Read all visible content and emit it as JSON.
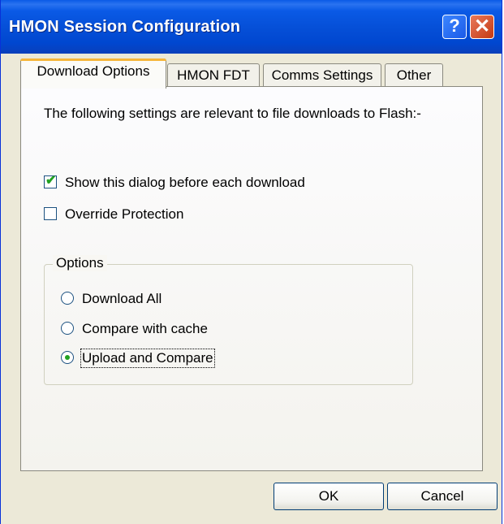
{
  "window": {
    "title": "HMON Session Configuration",
    "help_glyph": "?",
    "close_glyph": "✕",
    "accent_color": "#0a5ae6"
  },
  "tabs": [
    {
      "label": "Download Options",
      "active": true
    },
    {
      "label": "HMON FDT",
      "active": false
    },
    {
      "label": "Comms Settings",
      "active": false
    },
    {
      "label": "Other",
      "active": false
    }
  ],
  "panel": {
    "intro": "The following settings are relevant to file downloads to Flash:-",
    "checkboxes": [
      {
        "label": "Show this dialog before each download",
        "checked": true
      },
      {
        "label": "Override Protection",
        "checked": false
      }
    ],
    "options_group": {
      "legend": "Options",
      "radios": [
        {
          "label": "Download All",
          "selected": false
        },
        {
          "label": "Compare with cache",
          "selected": false
        },
        {
          "label": "Upload and Compare",
          "selected": true
        }
      ]
    }
  },
  "buttons": {
    "ok_label": "OK",
    "cancel_label": "Cancel"
  }
}
